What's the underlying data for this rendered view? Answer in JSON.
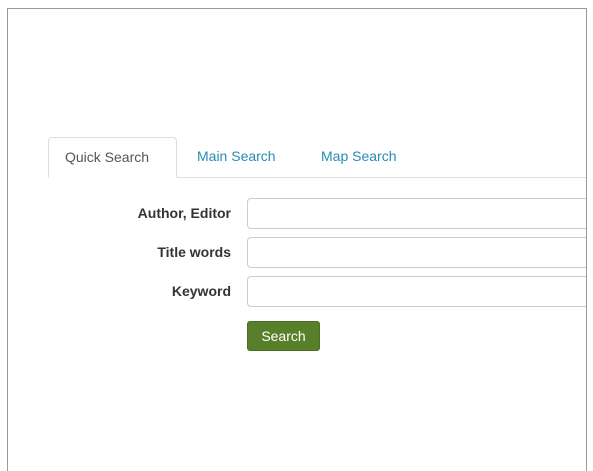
{
  "tabs": [
    {
      "label": "Quick Search",
      "active": true
    },
    {
      "label": "Main Search",
      "active": false
    },
    {
      "label": "Map Search",
      "active": false
    }
  ],
  "form": {
    "fields": [
      {
        "label": "Author, Editor",
        "value": "",
        "placeholder": ""
      },
      {
        "label": "Title words",
        "value": "",
        "placeholder": ""
      },
      {
        "label": "Keyword",
        "value": "",
        "placeholder": ""
      }
    ],
    "submit_label": "Search"
  },
  "colors": {
    "accent_button": "#58802a",
    "tab_link": "#2a8bb5",
    "active_tab_text": "#555555"
  }
}
